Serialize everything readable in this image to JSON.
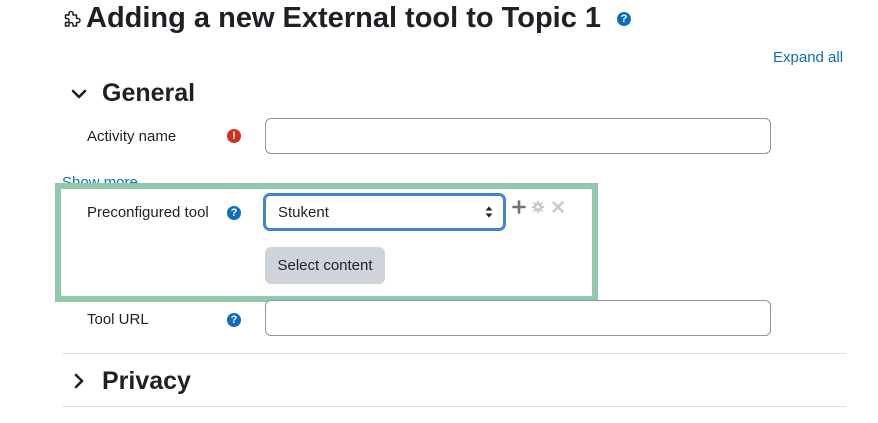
{
  "header": {
    "title": "Adding a new External tool to Topic 1",
    "title_help_glyph": "?",
    "expand_all_label": "Expand all"
  },
  "sections": {
    "general": {
      "title": "General",
      "activity_name": {
        "label": "Activity name",
        "value": "",
        "required_glyph": "!"
      },
      "show_more_label": "Show more...",
      "preconfigured_tool": {
        "label": "Preconfigured tool",
        "selected": "Stukent",
        "help_glyph": "?"
      },
      "select_content_label": "Select content",
      "tool_url": {
        "label": "Tool URL",
        "value": "",
        "help_glyph": "?"
      }
    },
    "privacy": {
      "title": "Privacy"
    }
  },
  "colors": {
    "link": "#0f6cbf",
    "required": "#ca3120",
    "highlight": "#8fc8ab",
    "select_focus": "#3d86d6",
    "secondary_button": "#ced4da"
  }
}
